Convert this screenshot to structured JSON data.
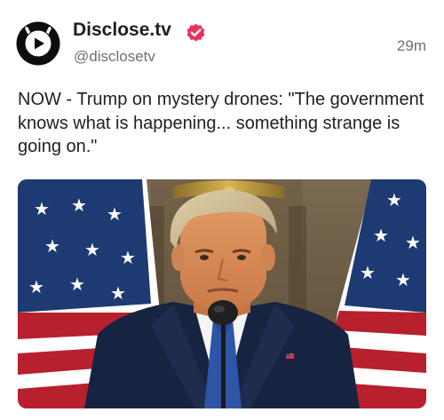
{
  "post": {
    "author": {
      "display_name": "Disclose.tv",
      "handle": "@disclosetv",
      "verified": true,
      "avatar_icon": "play-logo-icon",
      "verified_icon": "verified-badge-icon",
      "verified_color": "#e8315b"
    },
    "timestamp": "29m",
    "text": "NOW - Trump on mystery drones: \"The government knows what is happening... something strange is going on.\"",
    "media": {
      "type": "video-thumbnail"
    }
  }
}
